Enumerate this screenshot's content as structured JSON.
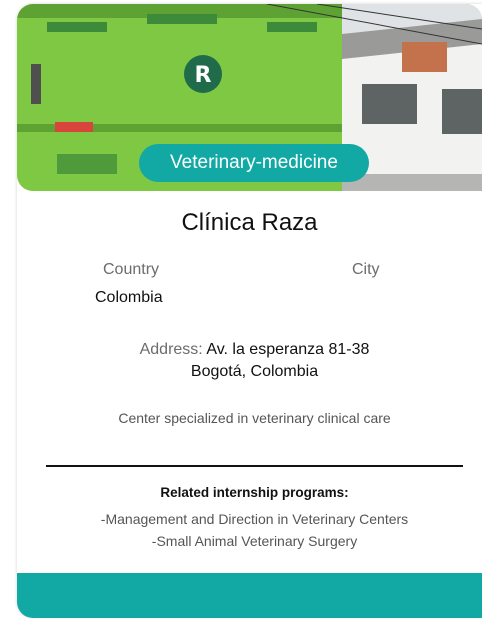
{
  "card": {
    "badge": "Veterinary-medicine",
    "title": "Clínica Raza",
    "country_label": "Country",
    "country_value": "Colombia",
    "city_label": "City",
    "address_label": "Address:",
    "address_line1": "Av. la esperanza 81-38",
    "address_line2": "Bogotá, Colombia",
    "description": "Center specialized in veterinary clinical care",
    "programs_title": "Related internship programs:",
    "programs": [
      "-Management and Direction in Veterinary Centers",
      "-Small Animal Veterinary Surgery"
    ]
  },
  "colors": {
    "accent": "#12a9a4",
    "facade_green": "#7ec843"
  }
}
